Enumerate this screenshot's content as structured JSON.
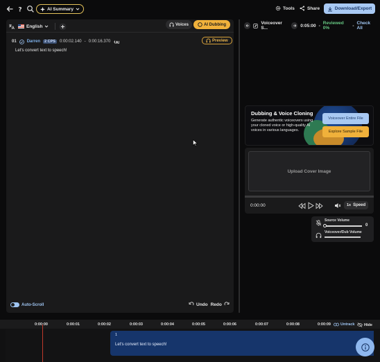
{
  "topbar": {
    "ai_summary_label": "AI Summary",
    "tools_label": "Tools",
    "share_label": "Share",
    "download_label": "Download/Export"
  },
  "editor": {
    "language": "English",
    "voices_label": "Voices",
    "ai_dubbing_label": "AI Dubbing",
    "segment": {
      "number": "01",
      "speaker": "Darren",
      "cps": "2 CPS",
      "start": "0:00:02.140",
      "separator": "-",
      "end": "0:00:16.370",
      "text": "Let's convert text to speech!"
    },
    "preview_label": "Preview",
    "autoscroll_label": "Auto-Scroll",
    "undo_label": "Undo",
    "redo_label": "Redo"
  },
  "right_header": {
    "title": "Voiceover S...",
    "time": "0:05:00",
    "separator": "-",
    "reviewed": "Reviewed 0%",
    "separator2": "-",
    "check_all": "Check All"
  },
  "promo": {
    "title": "Dubbing & Voice Cloning",
    "description": "Generate authentic voiceovers using your cloned voice or high-quality AI voices in various languages.",
    "button_primary": "Voiceover Entire File",
    "button_secondary": "Explore Sample File"
  },
  "player": {
    "upload_label": "Upload Cover Image",
    "current_time": "0:00:00",
    "speed_value": "1x",
    "speed_label": "Speed",
    "progress": 0
  },
  "volume": {
    "source_label": "Source Volume",
    "source_value": "0",
    "dub_label": "Voiceover/Dub Volume"
  },
  "timeline": {
    "ticks": [
      "0:00:00",
      "0:00:01",
      "0:00:02",
      "0:00:03",
      "0:00:04",
      "0:00:05",
      "0:00:06",
      "0:00:07",
      "0:00:08",
      "0:00:09"
    ],
    "untrack_label": "Untrack",
    "hide_label": "Hide",
    "clip_number": "1",
    "clip_text": "Let's convert text to speech!"
  },
  "colors": {
    "accent_blue": "#a8c9f3",
    "accent_yellow": "#f0b13b",
    "reviewed_green": "#67c983",
    "playhead_red": "#c0392b"
  }
}
